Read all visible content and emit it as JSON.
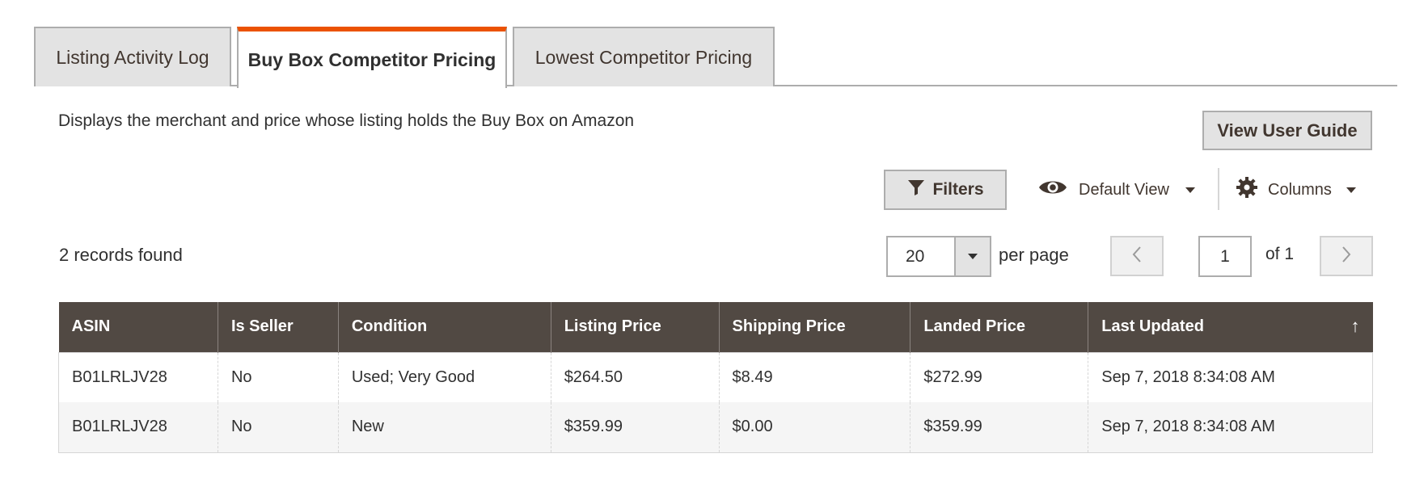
{
  "tabs": [
    {
      "label": "Listing Activity Log",
      "active": false
    },
    {
      "label": "Buy Box Competitor Pricing",
      "active": true
    },
    {
      "label": "Lowest Competitor Pricing",
      "active": false
    }
  ],
  "accent_color": "#eb5202",
  "header_color": "#514943",
  "description": "Displays the merchant and price whose listing holds the Buy Box on Amazon",
  "guide_button": "View User Guide",
  "toolbar": {
    "filters_label": "Filters",
    "filters_icon": "funnel-icon",
    "view_label": "Default View",
    "view_icon": "eye-icon",
    "columns_label": "Columns",
    "columns_icon": "gear-icon"
  },
  "records_found": "2 records found",
  "pagination": {
    "per_page_value": "20",
    "per_page_label": "per page",
    "current_page": "1",
    "of_label": "of 1"
  },
  "table": {
    "columns": [
      "ASIN",
      "Is Seller",
      "Condition",
      "Listing Price",
      "Shipping Price",
      "Landed Price",
      "Last Updated"
    ],
    "sort_indicator": "↑",
    "rows": [
      [
        "B01LRLJV28",
        "No",
        "Used; Very Good",
        "$264.50",
        "$8.49",
        "$272.99",
        "Sep 7, 2018 8:34:08 AM"
      ],
      [
        "B01LRLJV28",
        "No",
        "New",
        "$359.99",
        "$0.00",
        "$359.99",
        "Sep 7, 2018 8:34:08 AM"
      ]
    ]
  }
}
